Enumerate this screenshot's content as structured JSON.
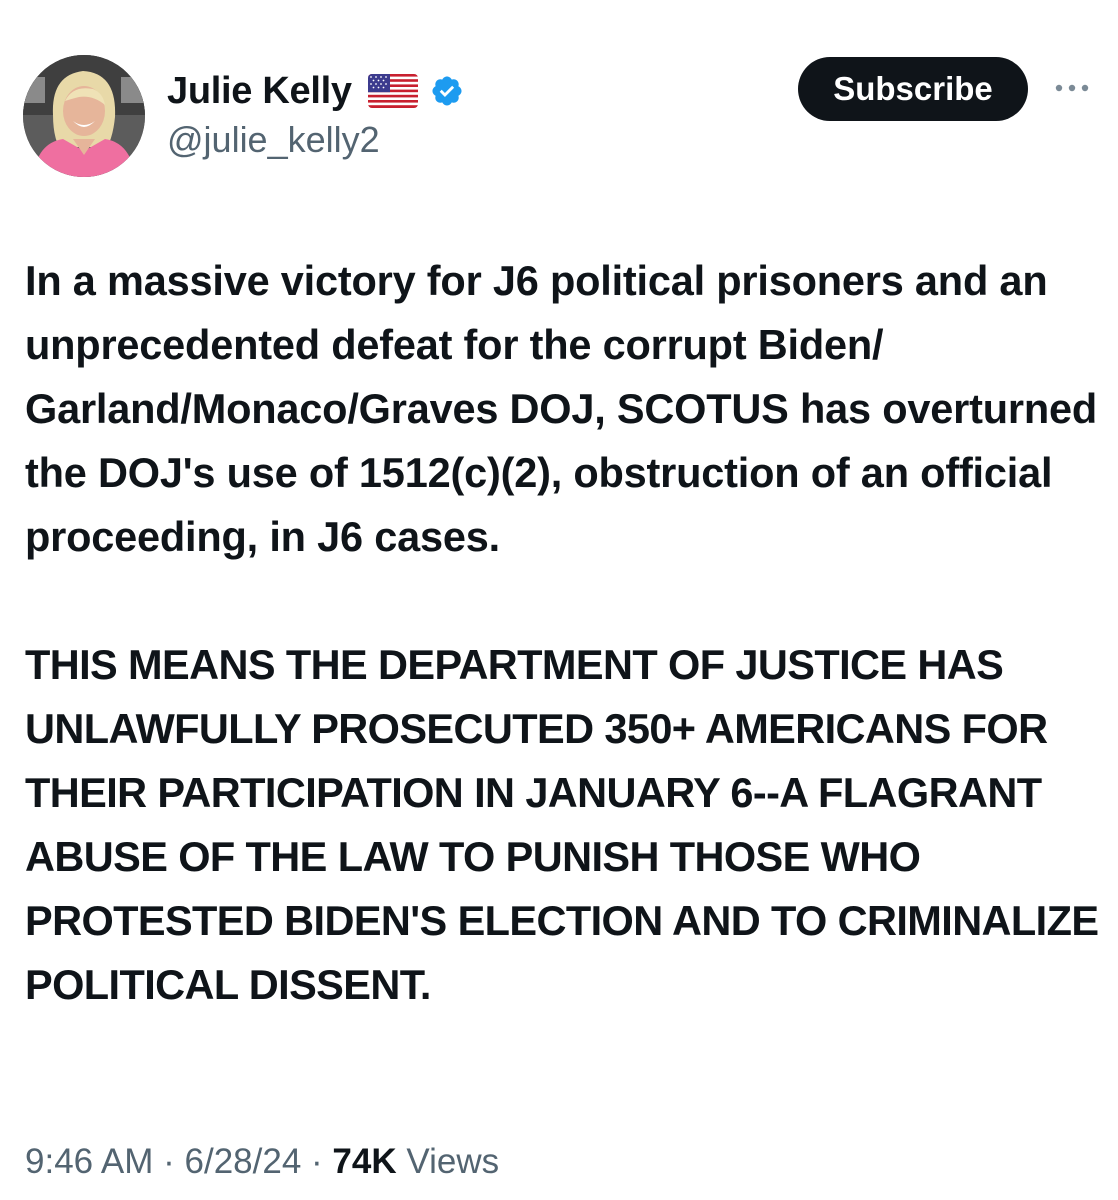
{
  "author": {
    "display_name": "Julie Kelly",
    "flag_icon": "us-flag-icon",
    "verified_icon": "verified-badge-icon",
    "verified_color": "#1d9bf0",
    "handle": "@julie_kelly2"
  },
  "header": {
    "subscribe_label": "Subscribe",
    "more_icon": "more-options-icon"
  },
  "tweet": {
    "paragraph1": "In a massive victory for J6 political prisoners and an unprecedented defeat for the corrupt Biden/ Garland/Monaco/Graves DOJ, SCOTUS has overturned the DOJ's use of 1512(c)(2), obstruction of an official proceeding, in J6 cases.",
    "paragraph2": "THIS MEANS THE DEPARTMENT OF JUSTICE HAS UNLAWFULLY PROSECUTED 350+ AMERICANS FOR THEIR PARTICIPATION IN JANUARY 6--A FLAGRANT ABUSE OF THE LAW TO PUNISH THOSE WHO PROTESTED BIDEN'S ELECTION AND TO CRIMINALIZE POLITICAL DISSENT."
  },
  "meta": {
    "time": "9:46 AM",
    "separator": " · ",
    "date": "6/28/24",
    "views_count": "74K",
    "views_label": " Views"
  },
  "colors": {
    "text_primary": "#0f1419",
    "text_secondary": "#536471",
    "button_bg": "#0f1419",
    "button_text": "#ffffff"
  }
}
